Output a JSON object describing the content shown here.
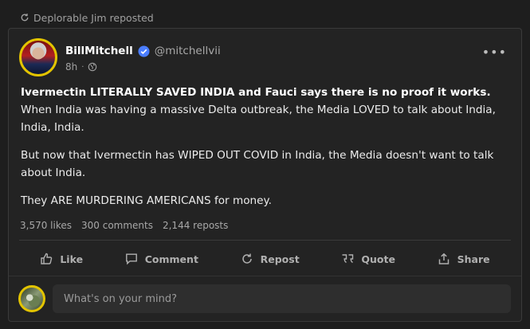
{
  "repost": {
    "label": "Deplorable Jim reposted",
    "icon": "repost-icon"
  },
  "post": {
    "author_name": "BillMitchell",
    "handle": "@mitchellvii",
    "verified": true,
    "verified_color": "#4a7dff",
    "time_ago": "8h",
    "separator": "·",
    "visibility_icon": "globe-icon",
    "more_label": "•••",
    "body_bold": "Ivermectin LITERALLY SAVED INDIA and Fauci says there is no proof it works.",
    "body_rest": " When India was having a massive Delta outbreak, the Media LOVED to talk about India, India, India.",
    "paragraph_2": "But now that Ivermectin has WIPED OUT COVID in India, the Media doesn't want to talk about India.",
    "paragraph_3": "They ARE MURDERING AMERICANS for money.",
    "stats": {
      "likes": "3,570 likes",
      "comments": "300 comments",
      "reposts": "2,144 reposts"
    },
    "actions": [
      {
        "label": "Like",
        "icon": "thumbs-up-icon"
      },
      {
        "label": "Comment",
        "icon": "comment-icon"
      },
      {
        "label": "Repost",
        "icon": "repost-icon"
      },
      {
        "label": "Quote",
        "icon": "quote-icon"
      },
      {
        "label": "Share",
        "icon": "share-icon"
      }
    ]
  },
  "composer": {
    "placeholder": "What's on your mind?"
  },
  "colors": {
    "background": "#1e1e1e",
    "card": "#232323",
    "avatar_ring": "#e3c400"
  }
}
